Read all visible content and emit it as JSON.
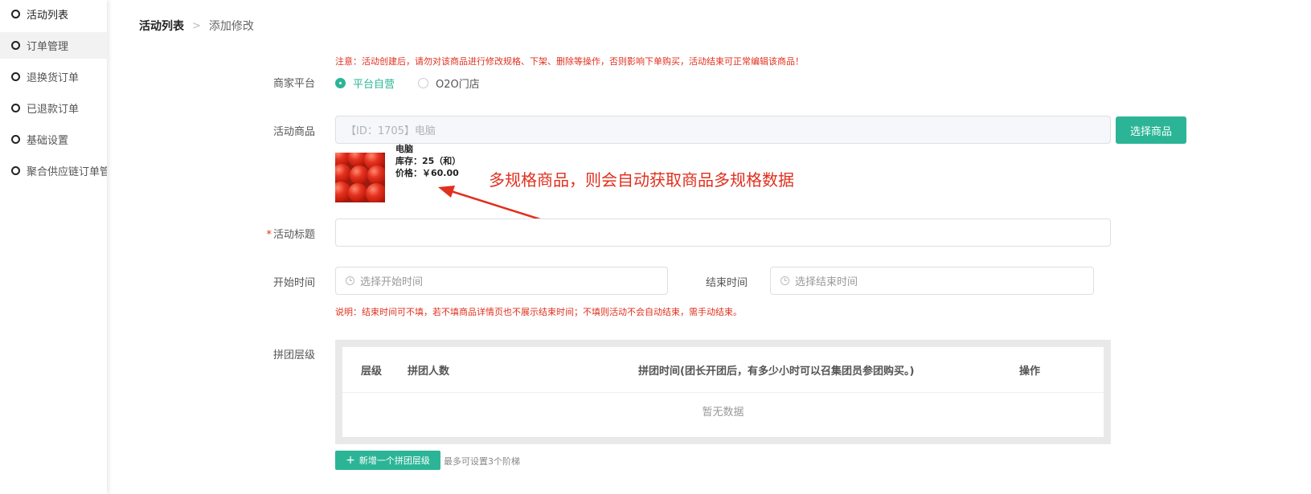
{
  "sidebar": {
    "items": [
      {
        "label": "活动列表"
      },
      {
        "label": "订单管理"
      },
      {
        "label": "退换货订单"
      },
      {
        "label": "已退款订单"
      },
      {
        "label": "基础设置"
      },
      {
        "label": "聚合供应链订单管理"
      }
    ]
  },
  "breadcrumb": {
    "root": "活动列表",
    "separator": ">",
    "current": "添加修改"
  },
  "notice_top": "注意：活动创建后，请勿对该商品进行修改规格、下架、删除等操作，否则影响下单购买，活动结束可正常编辑该商品！",
  "merchant_platform": {
    "label": "商家平台",
    "options": [
      {
        "label": "平台自营",
        "selected": true
      },
      {
        "label": "O2O门店",
        "selected": false
      }
    ]
  },
  "activity_product": {
    "label": "活动商品",
    "value": "【ID：1705】电脑",
    "select_button": "选择商品",
    "product": {
      "name": "电脑",
      "stock": "库存：25（和）",
      "price": "价格：￥60.00"
    }
  },
  "annotation": "多规格商品，则会自动获取商品多规格数据",
  "activity_title": {
    "label": "活动标题",
    "required_mark": "*",
    "value": ""
  },
  "start_time": {
    "label": "开始时间",
    "placeholder": "选择开始时间"
  },
  "end_time": {
    "label": "结束时间",
    "placeholder": "选择结束时间"
  },
  "notice_time": "说明：结束时间可不填，若不填商品详情页也不展示结束时间；不填则活动不会自动结束，需手动结束。",
  "group_tiers": {
    "label": "拼团层级",
    "columns": [
      "层级",
      "拼团人数",
      "拼团时间(团长开团后，有多少小时可以召集团员参团购买。)",
      "操作"
    ],
    "empty_text": "暂无数据",
    "add_button": "新增一个拼团层级",
    "hint": "最多可设置3个阶梯"
  },
  "colors": {
    "primary": "#2bb596",
    "danger": "#e0301e"
  }
}
